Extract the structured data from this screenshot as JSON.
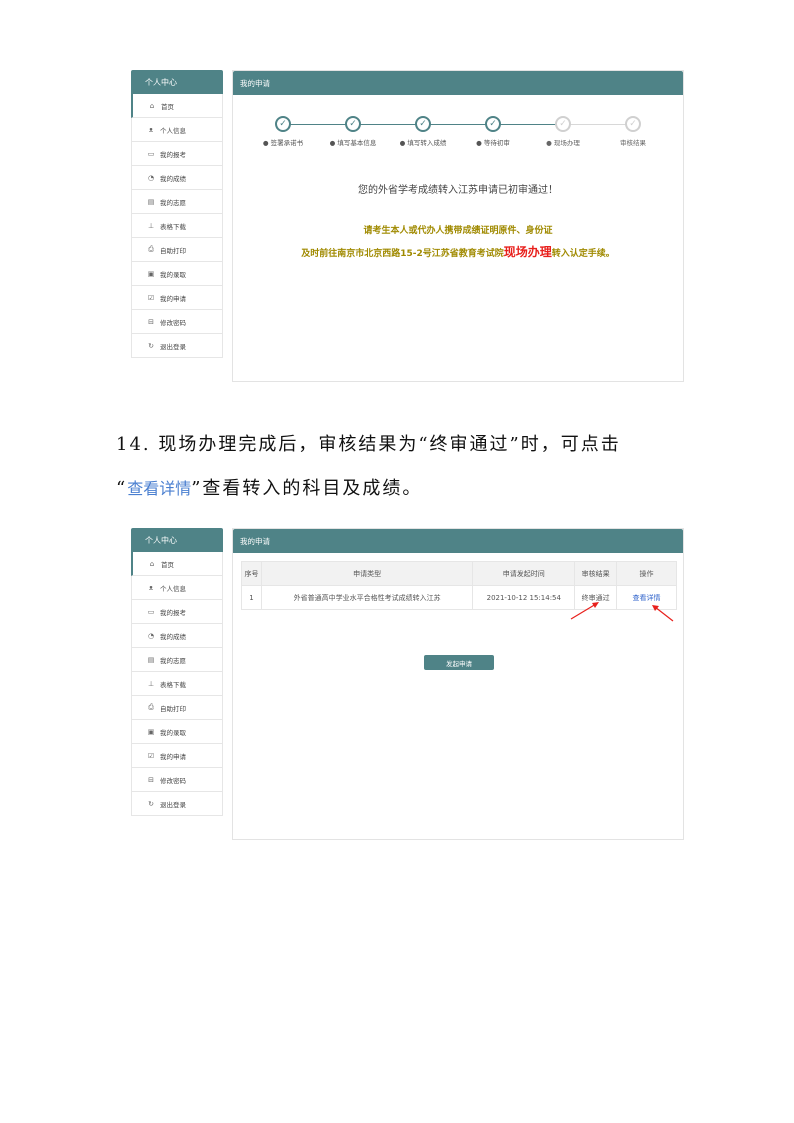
{
  "sidebar": {
    "title": "个人中心",
    "items": [
      {
        "label": "首页",
        "icon": "home-icon",
        "glyph": "⌂"
      },
      {
        "label": "个人信息",
        "icon": "user-icon",
        "glyph": "ᴥ"
      },
      {
        "label": "我的报考",
        "icon": "card-icon",
        "glyph": "▭"
      },
      {
        "label": "我的成绩",
        "icon": "clock-icon",
        "glyph": "◔"
      },
      {
        "label": "我的志愿",
        "icon": "document-icon",
        "glyph": "▤"
      },
      {
        "label": "表格下载",
        "icon": "download-icon",
        "glyph": "⊥"
      },
      {
        "label": "自助打印",
        "icon": "printer-icon",
        "glyph": "⎙"
      },
      {
        "label": "我的录取",
        "icon": "calendar-icon",
        "glyph": "▣"
      },
      {
        "label": "我的申请",
        "icon": "edit-icon",
        "glyph": "☑"
      },
      {
        "label": "修改密码",
        "icon": "lock-icon",
        "glyph": "⊟"
      },
      {
        "label": "退出登录",
        "icon": "logout-icon",
        "glyph": "↻"
      }
    ]
  },
  "panel_title": "我的申请",
  "screenshot1": {
    "steps": [
      {
        "label": "● 签署承诺书",
        "done": true
      },
      {
        "label": "● 填写基本信息",
        "done": true
      },
      {
        "label": "● 填写转入成绩",
        "done": true
      },
      {
        "label": "● 等待初审",
        "done": true
      },
      {
        "label": "● 现场办理",
        "done": false
      },
      {
        "label": "审核结果",
        "done": false
      }
    ],
    "message": "您的外省学考成绩转入江苏申请已初审通过！",
    "notice_line1": "请考生本人或代办人携带成绩证明原件、身份证",
    "notice_line2_pre": "及时前往南京市北京西路15-2号江苏省教育考试院",
    "notice_line2_highlight": "现场办理",
    "notice_line2_post": "转入认定手续。"
  },
  "paragraph": {
    "line1": "14.  现场办理完成后，审核结果为“终审通过”时，可点击",
    "line2_pre": "“",
    "line2_link": "查看详情",
    "line2_post": "”查看转入的科目及成绩。"
  },
  "screenshot2": {
    "columns": [
      "序号",
      "申请类型",
      "申请发起时间",
      "审核结果",
      "操作"
    ],
    "rows": [
      {
        "no": "1",
        "type": "外省普通高中学业水平合格性考试成绩转入江苏",
        "time": "2021-10-12 15:14:54",
        "result": "终审通过",
        "action": "查看详情"
      }
    ],
    "apply_button": "发起申请"
  },
  "colors": {
    "accent": "#4f8387",
    "highlight": "#e8201c",
    "notice": "#a08a00",
    "link": "#3366cc"
  }
}
